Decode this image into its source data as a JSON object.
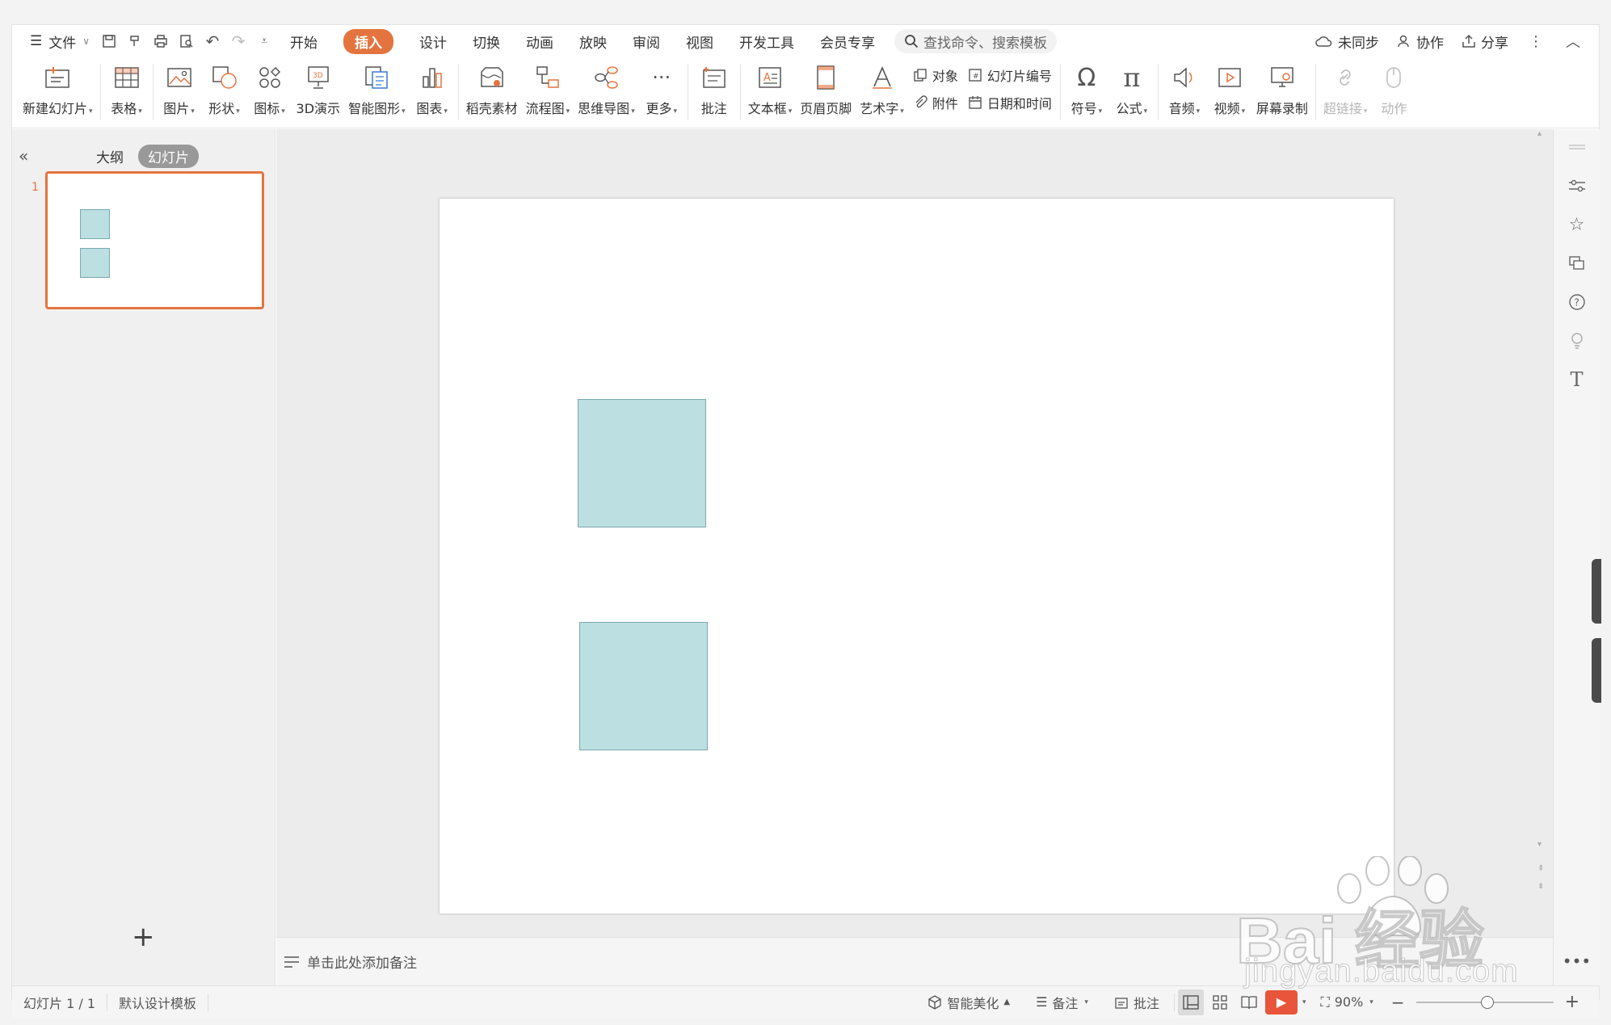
{
  "menu": {
    "file_label": "文件",
    "tabs": [
      {
        "label": "开始"
      },
      {
        "label": "插入"
      },
      {
        "label": "设计"
      },
      {
        "label": "切换"
      },
      {
        "label": "动画"
      },
      {
        "label": "放映"
      },
      {
        "label": "审阅"
      },
      {
        "label": "视图"
      },
      {
        "label": "开发工具"
      },
      {
        "label": "会员专享"
      }
    ],
    "active_tab": "插入",
    "search_placeholder": "查找命令、搜索模板",
    "sync_label": "未同步",
    "collab_label": "协作",
    "share_label": "分享"
  },
  "ribbon": {
    "new_slide": "新建幻灯片",
    "table": "表格",
    "picture": "图片",
    "shape": "形状",
    "icon": "图标",
    "demo3d": "3D演示",
    "smartart": "智能图形",
    "chart": "图表",
    "material": "稻壳素材",
    "flowchart": "流程图",
    "mindmap": "思维导图",
    "more": "更多",
    "comment": "批注",
    "textbox": "文本框",
    "header_footer": "页眉页脚",
    "wordart": "艺术字",
    "object": "对象",
    "slide_number": "幻灯片编号",
    "attachment": "附件",
    "datetime": "日期和时间",
    "symbol": "符号",
    "formula": "公式",
    "audio": "音频",
    "video": "视频",
    "screen_record": "屏幕录制",
    "hyperlink": "超链接",
    "action": "动作"
  },
  "left_panel": {
    "outline_tab": "大纲",
    "slides_tab": "幻灯片",
    "slide_number": "1"
  },
  "notes_placeholder": "单击此处添加备注",
  "status": {
    "slide_info": "幻灯片 1 / 1",
    "template": "默认设计模板",
    "beautify": "智能美化",
    "notes": "备注",
    "comment": "批注",
    "zoom": "90%"
  },
  "shape_fill": "#bcdfe1",
  "shape_border": "#7aa9b0",
  "accent": "#e4743f",
  "watermark": {
    "brand": "Bai  经验",
    "url": "jingyan.baidu.com"
  }
}
